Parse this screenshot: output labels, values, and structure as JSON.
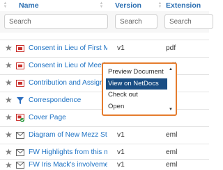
{
  "columns": {
    "name": "Name",
    "version": "Version",
    "extension": "Extension"
  },
  "search": {
    "name_placeholder": "Search",
    "version_placeholder": "Search",
    "extension_placeholder": "Search"
  },
  "rows": [
    {
      "name": "Consent in Lieu of First M...",
      "version": "v1",
      "extension": "pdf",
      "icon": "pdf-icon"
    },
    {
      "name": "Consent in Lieu of Meetin...",
      "version": "v1",
      "extension": "pdf",
      "icon": "pdf-icon"
    },
    {
      "name": "Contribution and Assignm...",
      "version": "v1",
      "extension": "pdf",
      "icon": "pdf-icon"
    },
    {
      "name": "Correspondence",
      "version": "",
      "extension": "",
      "icon": "filter-icon"
    },
    {
      "name": "Cover Page",
      "version": "",
      "extension": "",
      "icon": "pdf-checked-icon"
    },
    {
      "name": "Diagram of New Mezz Str...",
      "version": "v1",
      "extension": "eml",
      "icon": "email-icon"
    },
    {
      "name": "FW Highlights from this m...",
      "version": "v1",
      "extension": "eml",
      "icon": "email-icon"
    },
    {
      "name": "FW Iris Mack's involveme...",
      "version": "v1",
      "extension": "eml",
      "icon": "email-icon"
    }
  ],
  "context_menu": {
    "items": [
      "Preview Document",
      "View on NetDocs",
      "Check out",
      "Open"
    ],
    "selected": "View on NetDocs"
  },
  "colors": {
    "link": "#1f73c4",
    "accent_border": "#e57c2d",
    "selected_bg": "#1a4e84",
    "pdf_red": "#c9302c",
    "filter_blue": "#2d6fc0"
  }
}
